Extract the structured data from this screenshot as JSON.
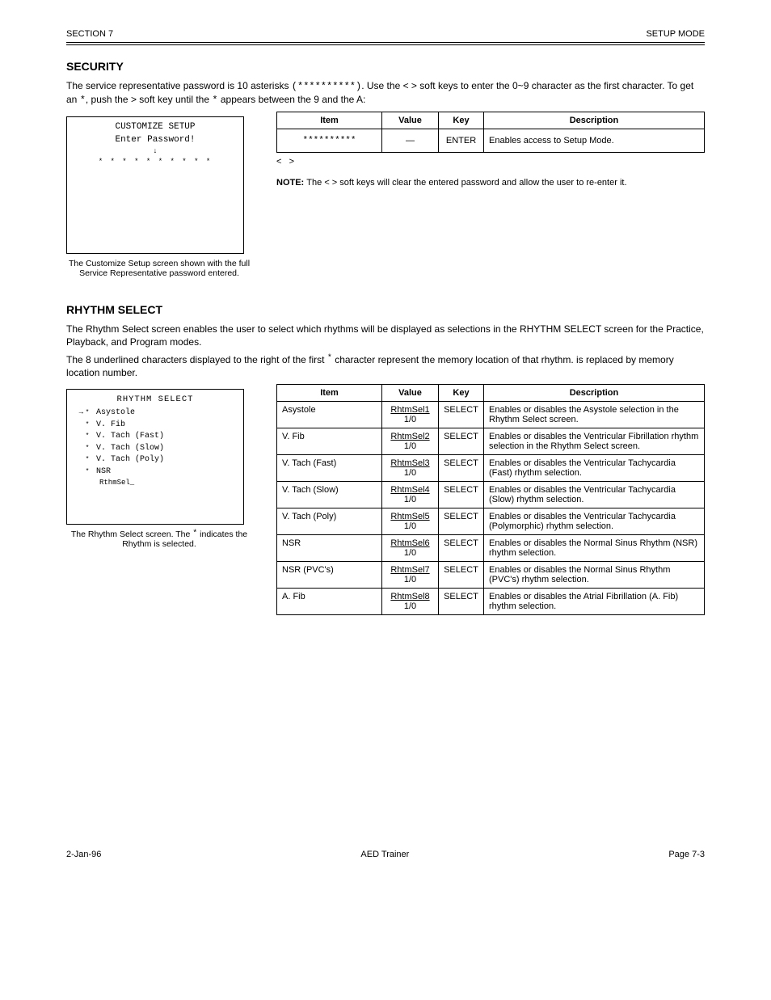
{
  "header": {
    "left": "SECTION 7",
    "right": "SETUP MODE"
  },
  "section1": {
    "title": "SECURITY",
    "p1_a": "The service representative password is 10 asterisks ",
    "p1_b": ". Use the ",
    "p1_c": " soft keys to enter the 0",
    "p1_d": "9 character as the first character. To get an ",
    "p1_e": ", push the ",
    "p1_f": " soft key until the ",
    "p1_g": " appears between the 9 and the A:",
    "stars_literal": "(**********)",
    "angle_keys": "< >",
    "range": "~",
    "asterisk_char": "*",
    "lcd": {
      "line1": "CUSTOMIZE SETUP",
      "line2": "Enter Password!",
      "stars": "* * * * * * * * * *"
    },
    "caption": "The Customize Setup screen shown with the full Service Representative password entered.",
    "table": {
      "headers": [
        "Item",
        "Value",
        "Key",
        "Description"
      ],
      "row": {
        "item": "**********",
        "value": "—",
        "key": "ENTER",
        "desc": "Enables access to Setup Mode."
      }
    },
    "note_label": "NOTE:",
    "note_a": "The ",
    "note_b": " soft keys will clear the entered password and allow the user to re-enter it."
  },
  "section2": {
    "title": "RHYTHM SELECT",
    "p1": "The Rhythm Select screen enables the user to select which rhythms will be displayed as selections in the RHYTHM SELECT screen for the Practice, Playback, and Program modes.",
    "p2_a": "The 8 underlined characters displayed to the right of the first ",
    "p2_b": " character represent the memory location of that rhythm. is replaced by memory location number.",
    "menu": {
      "title": "RHYTHM SELECT",
      "arrow": "→",
      "prefix": "*",
      "items": [
        "Asystole",
        "V. Fib",
        "V. Tach (Fast)",
        "V. Tach (Slow)",
        "V. Tach (Poly)",
        "NSR"
      ],
      "rhythm_sel_fragment": "RthmSel_"
    },
    "caption_a": "The Rhythm Select screen. The ",
    "caption_b": " indicates the Rhythm is selected.",
    "table": {
      "headers": [
        "Item",
        "Value",
        "Key",
        "Description"
      ],
      "rows": [
        {
          "item": "Asystole",
          "val_a": "RhtmSel1",
          "val_b": "1/0",
          "key": "SELECT",
          "desc": "Enables or disables the Asystole selection in the Rhythm Select screen."
        },
        {
          "item": "V. Fib",
          "val_a": "RhtmSel2",
          "val_b": "1/0",
          "key": "SELECT",
          "desc": "Enables or disables the Ventricular Fibrillation rhythm selection in the Rhythm Select screen."
        },
        {
          "item": "V. Tach (Fast)",
          "val_a": "RhtmSel3",
          "val_b": "1/0",
          "key": "SELECT",
          "desc": "Enables or disables the Ventricular Tachycardia (Fast) rhythm selection."
        },
        {
          "item": "V. Tach (Slow)",
          "val_a": "RhtmSel4",
          "val_b": "1/0",
          "key": "SELECT",
          "desc": "Enables or disables the Ventricular Tachycardia (Slow) rhythm selection."
        },
        {
          "item": "V. Tach (Poly)",
          "val_a": "RhtmSel5",
          "val_b": "1/0",
          "key": "SELECT",
          "desc": "Enables or disables the Ventricular Tachycardia (Polymorphic) rhythm selection."
        },
        {
          "item": "NSR",
          "val_a": "RhtmSel6",
          "val_b": "1/0",
          "key": "SELECT",
          "desc": "Enables or disables the Normal Sinus Rhythm (NSR) rhythm selection."
        },
        {
          "item": "NSR (PVC's)",
          "val_a": "RhtmSel7",
          "val_b": "1/0",
          "key": "SELECT",
          "desc": "Enables or disables the Normal Sinus Rhythm (PVC's) rhythm selection."
        },
        {
          "item": "A. Fib",
          "val_a": "RhtmSel8",
          "val_b": "1/0",
          "key": "SELECT",
          "desc": "Enables or disables the Atrial Fibrillation (A. Fib) rhythm selection."
        }
      ]
    }
  },
  "footer": {
    "left": "2-Jan-96",
    "center": "AED Trainer",
    "right": "Page 7-3"
  }
}
